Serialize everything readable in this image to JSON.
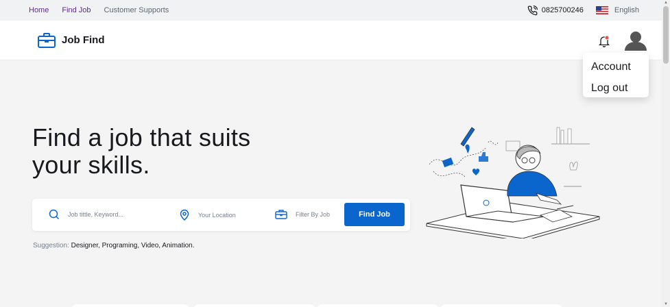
{
  "topbar": {
    "nav": [
      {
        "label": "Home"
      },
      {
        "label": "Find Job"
      },
      {
        "label": "Customer Supports"
      }
    ],
    "phone": "0825700246",
    "language": "English"
  },
  "header": {
    "brand": "Job Find"
  },
  "account_menu": {
    "items": [
      {
        "label": "Account"
      },
      {
        "label": "Log out"
      }
    ]
  },
  "hero": {
    "title_line1": "Find a job that suits",
    "title_line2": "your skills."
  },
  "search": {
    "keyword_placeholder": "Job tittle, Keyword...",
    "location_placeholder": "Your Location",
    "filter_label": "Filter By Job",
    "button_label": "Find Job"
  },
  "suggestion": {
    "label": "Suggestion:",
    "items": " Designer, Programing, Video,  Animation."
  },
  "colors": {
    "primary": "#0a65cc",
    "active_nav": "#5b2e8a",
    "notification_dot": "#e05151"
  }
}
